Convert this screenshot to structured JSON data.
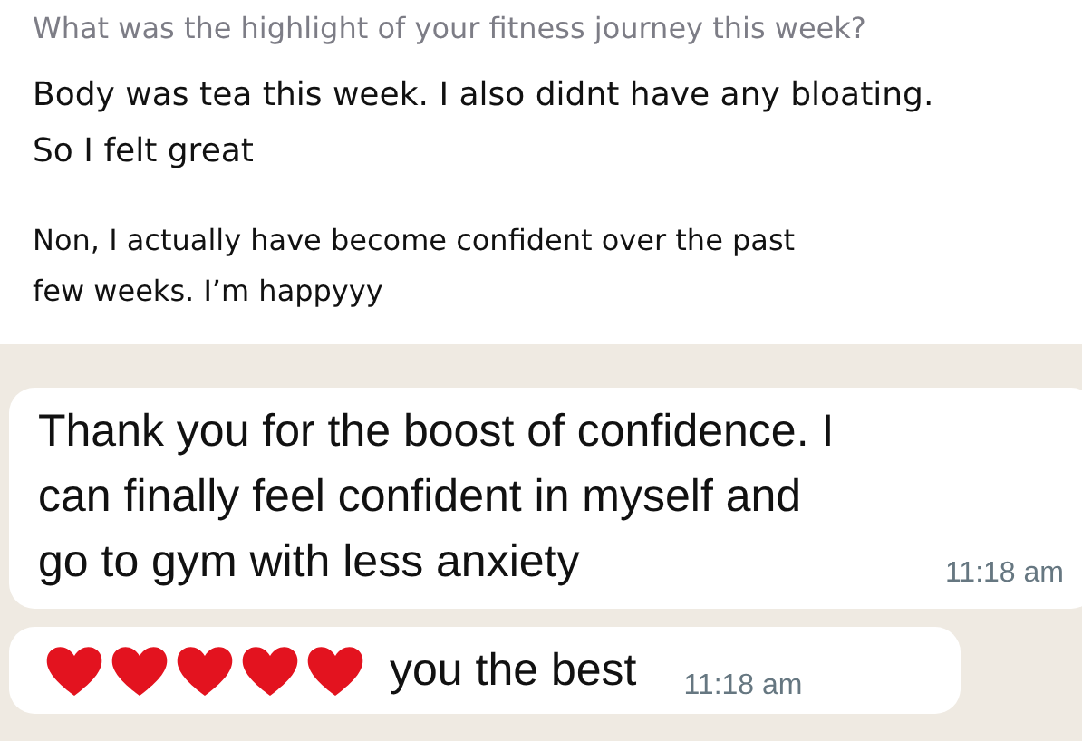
{
  "survey": {
    "question": "What was the highlight of your fitness journey this week?",
    "answers": [
      "Body was tea this week. I also didnt have any bloating. So I felt great",
      "Non, I actually have become confident over the past few weeks. I’m happyyy"
    ]
  },
  "messages": [
    {
      "text": "Thank you for the boost of confidence. I can finally feel confident in myself and go to gym with less anxiety",
      "time": "11:18 am"
    },
    {
      "text": "you the best",
      "time": "11:18 am",
      "icons": [
        {
          "kind": "heart"
        },
        {
          "kind": "heart"
        },
        {
          "kind": "heart"
        },
        {
          "kind": "heart"
        },
        {
          "kind": "heart"
        }
      ]
    }
  ]
}
